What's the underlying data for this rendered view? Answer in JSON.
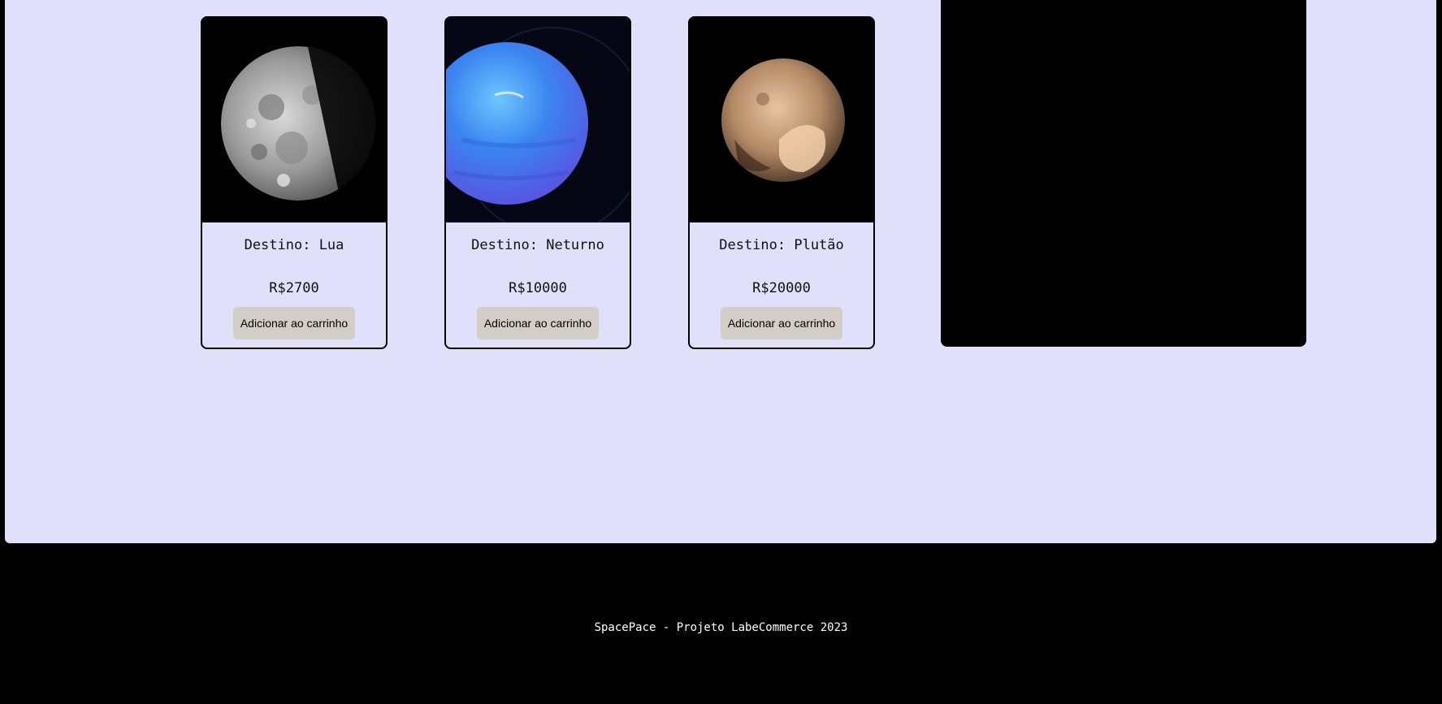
{
  "products": [
    {
      "title": "Destino: Lua",
      "price": "R$2700",
      "button_label": "Adicionar ao carrinho",
      "image": "moon-photo"
    },
    {
      "title": "Destino: Neturno",
      "price": "R$10000",
      "button_label": "Adicionar ao carrinho",
      "image": "neptune-photo"
    },
    {
      "title": "Destino: Plutão",
      "price": "R$20000",
      "button_label": "Adicionar ao carrinho",
      "image": "pluto-photo"
    }
  ],
  "footer": {
    "text": "SpacePace - Projeto LabeCommerce 2023"
  },
  "colors": {
    "background": "#E0E0FB",
    "page_frame": "#000000",
    "button": "#D3CEC5"
  }
}
